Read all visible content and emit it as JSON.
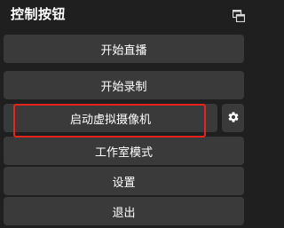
{
  "dock": {
    "title": "控制按钮",
    "float_icon": "float-window-icon"
  },
  "buttons": {
    "start_stream": "开始直播",
    "start_recording": "开始录制",
    "start_virtual_camera": "启动虚拟摄像机",
    "studio_mode": "工作室模式",
    "settings": "设置",
    "exit": "退出"
  },
  "virtual_camera_settings_icon": "gear-icon",
  "colors": {
    "background": "#1f1f1f",
    "button": "#3a3a3a",
    "text": "#ffffff",
    "highlight": "#e8231e"
  }
}
